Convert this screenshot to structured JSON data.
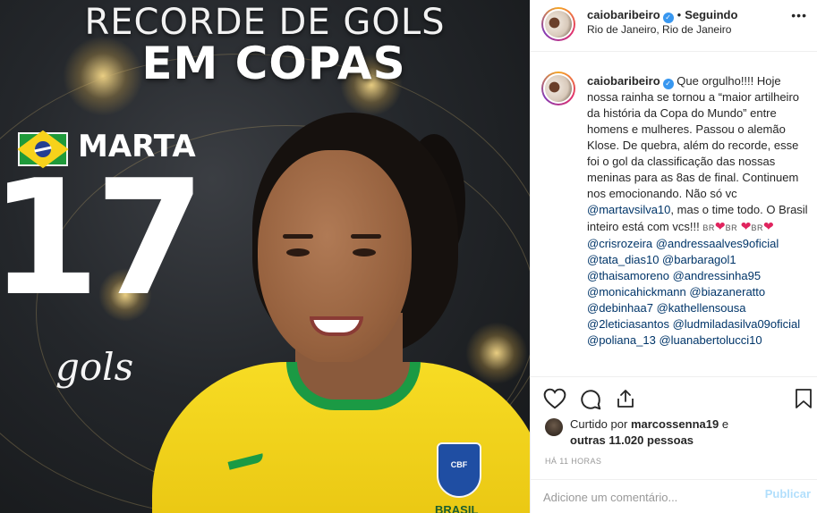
{
  "colors": {
    "accent_link": "#003569",
    "verified_blue": "#3897f0",
    "publish_disabled": "#b2dffc",
    "heart_red": "#e0245e"
  },
  "image": {
    "headline_line1": "RECORDE DE GOLS",
    "headline_line2": "EM COPAS",
    "player_name": "MARTA",
    "goals_number": "17",
    "goals_label": "gols",
    "crest_label": "CBF",
    "brasil_label": "BRASIL"
  },
  "header": {
    "username": "caiobaribeiro",
    "verified_icon": "verified-badge-icon",
    "separator": "•",
    "follow_status": "Seguindo",
    "location": "Rio de Janeiro, Rio de Janeiro",
    "more_icon": "more-options-icon"
  },
  "caption": {
    "username": "caiobaribeiro",
    "part1": "Que orgulho!!!! Hoje nossa rainha se tornou a “maior artilheiro da história da Copa do Mundo” entre homens e mulheres. Passou o alemão Klose. De quebra, além do recorde, esse foi o gol da classificação das nossas meninas para as 8as de final. Continuem nos emocionando. Não só vc",
    "mention_marta": "@martavsilva10",
    "part2": ", mas o time todo. O Brasil inteiro está com vcs!!!",
    "flag_text": "BR",
    "mentions": [
      "@crisrozeira",
      "@andressaalves9oficial",
      "@tata_dias10",
      "@barbaragol1",
      "@thaisamoreno",
      "@andressinha95",
      "@monicahickmann",
      "@biazaneratto",
      "@debinhaa7",
      "@kathellensousa",
      "@2leticiasantos",
      "@ludmiladasilva09oficial",
      "@poliana_13",
      "@luanabertolucci10"
    ]
  },
  "actions": {
    "like_icon": "heart-icon",
    "comment_icon": "comment-icon",
    "share_icon": "share-icon",
    "save_icon": "bookmark-icon"
  },
  "likes": {
    "prefix": "Curtido por",
    "user": "marcossenna19",
    "connector": "e",
    "others": "outras 11.020 pessoas"
  },
  "timestamp": "HÁ 11 HORAS",
  "comment_box": {
    "placeholder": "Adicione um comentário...",
    "publish_label": "Publicar"
  }
}
